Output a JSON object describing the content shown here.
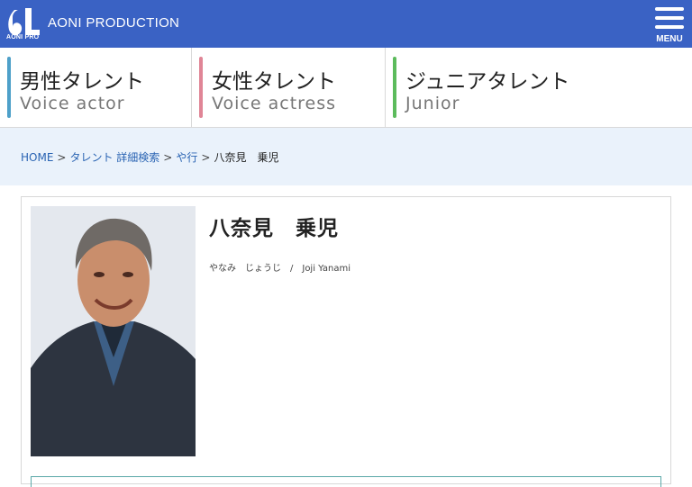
{
  "header": {
    "logo_text": "AONI PRO",
    "brand": "AONI PRODUCTION",
    "menu_label": "MENU",
    "background": "#3a62c4"
  },
  "categories": [
    {
      "jp": "男性タレント",
      "en": "Voice actor",
      "color": "#4ea0c9"
    },
    {
      "jp": "女性タレント",
      "en": "Voice actress",
      "color": "#e08596"
    },
    {
      "jp": "ジュニアタレント",
      "en": "Junior",
      "color": "#5cbb5c"
    }
  ],
  "breadcrumb": {
    "home": "HOME",
    "sep": ">",
    "talent_search": "タレント 詳細検索",
    "row": "や行",
    "current": "八奈見　乗児"
  },
  "profile": {
    "name": "八奈見　乗児",
    "reading": "やなみ　じょうじ　/　Joji Yanami"
  }
}
